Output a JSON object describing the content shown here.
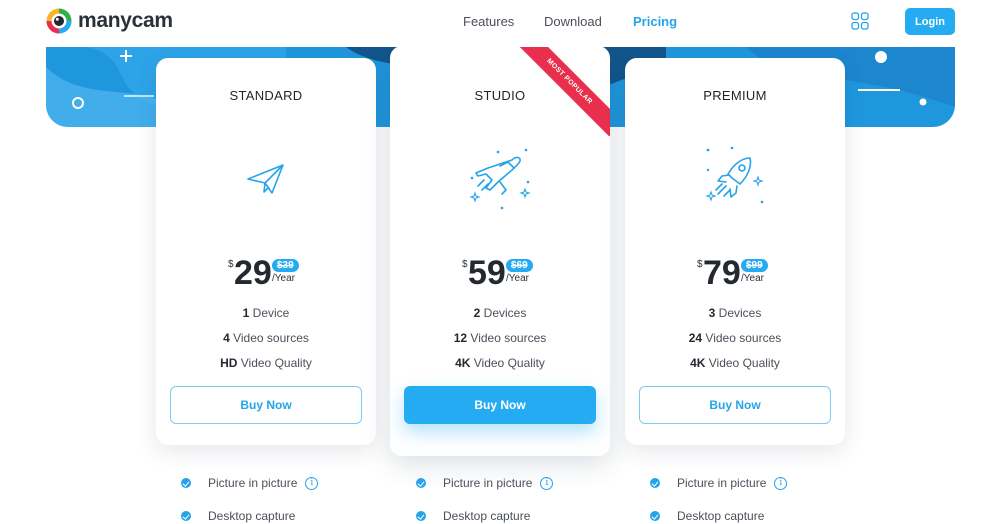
{
  "header": {
    "brand": "manycam",
    "nav": [
      {
        "label": "Features",
        "active": false
      },
      {
        "label": "Download",
        "active": false
      },
      {
        "label": "Pricing",
        "active": true
      }
    ],
    "apps_icon": "grid-icon",
    "login_label": "Login"
  },
  "colors": {
    "accent": "#25abf2",
    "band": "#1f97dd",
    "ribbon": "#e8304e"
  },
  "plans": [
    {
      "name": "STANDARD",
      "icon": "paper-plane-icon",
      "currency": "$",
      "price": "29",
      "old_price": "$39",
      "period": "/Year",
      "features": [
        {
          "bold": "1",
          "text": " Device"
        },
        {
          "bold": "4",
          "text": " Video sources"
        },
        {
          "bold": "HD",
          "text": " Video Quality"
        }
      ],
      "button": "Buy Now"
    },
    {
      "name": "STUDIO",
      "icon": "airplane-icon",
      "ribbon": "MOST POPULAR",
      "currency": "$",
      "price": "59",
      "old_price": "$69",
      "period": "/Year",
      "features": [
        {
          "bold": "2",
          "text": " Devices"
        },
        {
          "bold": "12",
          "text": " Video sources"
        },
        {
          "bold": "4K",
          "text": " Video Quality"
        }
      ],
      "button": "Buy Now"
    },
    {
      "name": "PREMIUM",
      "icon": "rocket-icon",
      "currency": "$",
      "price": "79",
      "old_price": "$99",
      "period": "/Year",
      "features": [
        {
          "bold": "3",
          "text": " Devices"
        },
        {
          "bold": "24",
          "text": " Video sources"
        },
        {
          "bold": "4K",
          "text": " Video Quality"
        }
      ],
      "button": "Buy Now"
    }
  ],
  "extras": [
    {
      "label": "Picture in picture",
      "info": "i"
    },
    {
      "label": "Desktop capture"
    }
  ]
}
